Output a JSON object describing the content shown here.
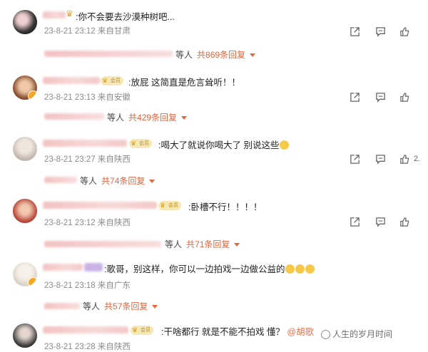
{
  "comments": [
    {
      "text": ":你不会要去沙漠种树吧...",
      "date": "23-8-21 23:12",
      "location": "来自甘肃",
      "reply_deng": "等人",
      "reply_count": "共869条回复",
      "like_count": "",
      "avatar_color": "#2b2b2b",
      "vip_label": ""
    },
    {
      "text": ":放屁 这简直是危言耸听！！",
      "date": "23-8-21 23:13",
      "location": "来自安徽",
      "reply_deng": "等人",
      "reply_count": "共429条回复",
      "like_count": "",
      "avatar_color": "#a0522d",
      "vip_label": "会员"
    },
    {
      "text": ":喝大了就说你喝大了 别说这些",
      "date": "23-8-21 23:27",
      "location": "来自陕西",
      "reply_deng": "等人",
      "reply_count": "共74条回复",
      "like_count": "2.",
      "avatar_color": "#d9cfc8",
      "vip_label": "会员"
    },
    {
      "text": ":卧槽不行！！！！",
      "date": "23-8-21 23:12",
      "location": "来自陕西",
      "reply_deng": "等人",
      "reply_count": "共71条回复",
      "like_count": "",
      "avatar_color": "#c0392b",
      "vip_label": "会员"
    },
    {
      "text": ":歌哥，别这样，你可以一边拍戏一边做公益的",
      "date": "23-8-21 23:18",
      "location": "来自广东",
      "reply_deng": "等人",
      "reply_count": "共57条回复",
      "like_count": "",
      "avatar_color": "#e8e2d8",
      "vip_label": ""
    },
    {
      "text": ":干啥都行 就是不能不拍戏 懂？",
      "mention": "@胡歌",
      "date": "23-8-21 23:28",
      "location": "来自陕西",
      "like_count": "",
      "avatar_color": "#3a3a3a",
      "vip_label": "会员"
    }
  ],
  "watermark": "人生的岁月时间",
  "colors": {
    "reply_accent": "#e5653d",
    "meta_gray": "#8a8a8a"
  },
  "icons": [
    "share-icon",
    "comment-icon",
    "like-icon"
  ]
}
